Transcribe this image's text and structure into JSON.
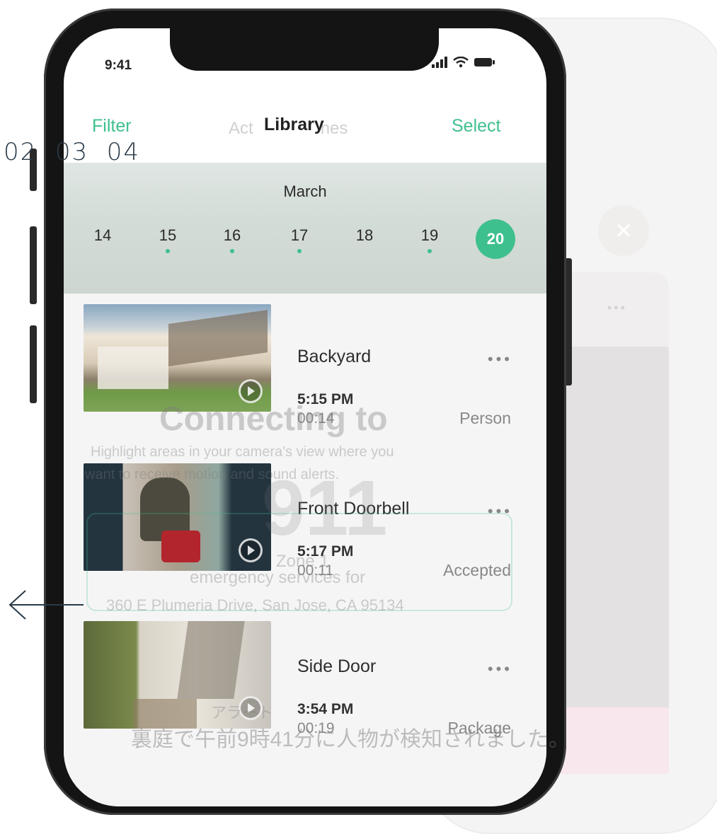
{
  "status_bar": {
    "time": "9:41"
  },
  "nav": {
    "left": "Filter",
    "title": "Library",
    "ghost_title_left": "Act",
    "ghost_title_right": "nes",
    "right": "Select"
  },
  "calendar": {
    "month": "March",
    "days": [
      {
        "num": "14",
        "has_event": false
      },
      {
        "num": "15",
        "has_event": true
      },
      {
        "num": "16",
        "has_event": true
      },
      {
        "num": "17",
        "has_event": true
      },
      {
        "num": "18",
        "has_event": false
      },
      {
        "num": "19",
        "has_event": true
      },
      {
        "num": "20",
        "has_event": false,
        "selected": true
      }
    ]
  },
  "clips": [
    {
      "name": "Backyard",
      "time": "5:15 PM",
      "duration": "00:14",
      "tag": "Person",
      "more": "•••"
    },
    {
      "name": "Front Doorbell",
      "time": "5:17 PM",
      "duration": "00:11",
      "tag": "Accepted",
      "more": "•••"
    },
    {
      "name": "Side Door",
      "time": "3:54 PM",
      "duration": "00:19",
      "tag": "Package",
      "more": "•••"
    }
  ],
  "overlay": {
    "connecting": "Connecting to",
    "highlight": "Highlight areas in your camera's view where you",
    "alerts": "want to receive motion and sound alerts.",
    "nine_one_one": "911",
    "zone": "Zone 1",
    "emergency": "emergency services for",
    "address": "360 E Plumeria Drive, San Jose, CA 95134",
    "jp_small": "アラート",
    "jp_message": "裏庭で午前9時41分に人物が検知されました。"
  },
  "step_nav": {
    "steps": "02  03  04"
  },
  "colors": {
    "accent": "#3ec08e",
    "text": "#2e2e2e",
    "muted": "#888888"
  }
}
